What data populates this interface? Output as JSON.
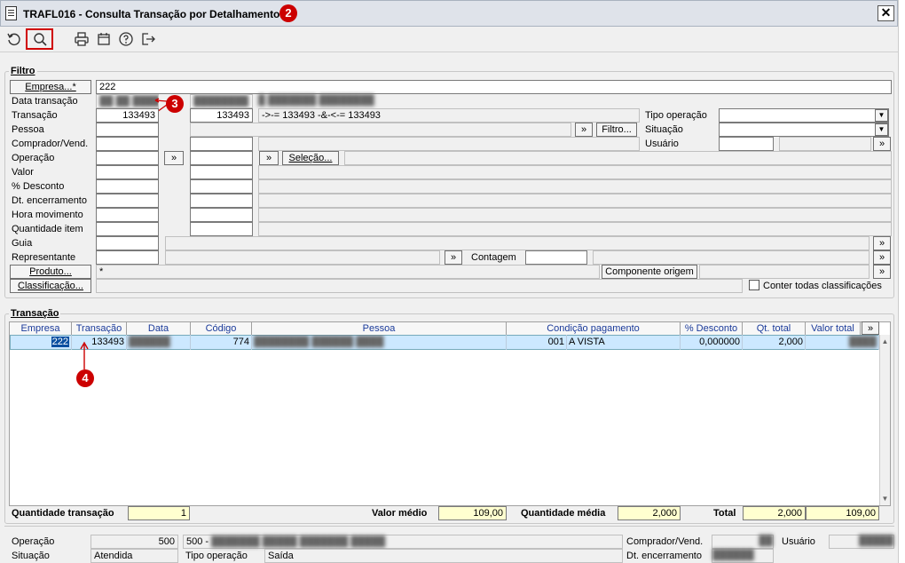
{
  "window": {
    "title": "TRAFL016 - Consulta Transação por Detalhamento",
    "close_glyph": "✕",
    "badges": {
      "b2": "2",
      "b3": "3",
      "b4": "4"
    }
  },
  "toolbar": {
    "icons": [
      "refresh-icon",
      "search-icon",
      "print-icon",
      "calendar-icon",
      "help-icon",
      "exit-icon"
    ]
  },
  "filtro": {
    "legend": "Filtro",
    "empresa_btn": "Empresa...*",
    "empresa_value": "222",
    "labels": [
      "Data transação",
      "Transação",
      "Pessoa",
      "Comprador/Vend.",
      "Operação",
      "Valor",
      "% Desconto",
      "Dt. encerramento",
      "Hora movimento",
      "Quantidade item",
      "Guia",
      "Representante"
    ],
    "transacao_from": "133493",
    "transacao_to": "133493",
    "transacao_expr": "->-= 133493 -&-<-= 133493",
    "filtro_btn": "Filtro...",
    "selecao_btn": "Seleção...",
    "tipo_operacao_label": "Tipo operação",
    "situacao_label": "Situação",
    "usuario_label": "Usuário",
    "contagem_label": "Contagem",
    "produto_btn": "Produto...",
    "produto_value": "*",
    "componente_label": "Componente origem",
    "classificacao_btn": "Classificação...",
    "conter_label": "Conter todas classificações",
    "more": "»"
  },
  "transacao": {
    "legend": "Transação",
    "columns": [
      "Empresa",
      "Transação",
      "Data",
      "Código",
      "Pessoa",
      "Condição pagamento",
      "% Desconto",
      "Qt. total",
      "Valor total"
    ],
    "row": {
      "empresa": "222",
      "transacao": "133493",
      "codigo": "774",
      "cond_code": "001",
      "cond": "A VISTA",
      "desconto": "0,000000",
      "qt_total": "2,000"
    }
  },
  "totals": {
    "qtd_transacao_label": "Quantidade transação",
    "qtd_transacao": "1",
    "valor_medio_label": "Valor médio",
    "valor_medio": "109,00",
    "qtd_media_label": "Quantidade média",
    "qtd_media": "2,000",
    "total_label": "Total",
    "total_qt": "2,000",
    "total_valor": "109,00"
  },
  "footer": {
    "operacao_label": "Operação",
    "operacao_value": "500",
    "operacao_desc": "500 -",
    "situacao_label": "Situação",
    "situacao_value": "Atendida",
    "tipo_operacao_label": "Tipo operação",
    "tipo_operacao_value": "Saída",
    "comprador_label": "Comprador/Vend.",
    "usuario_label": "Usuário",
    "dt_enc_label": "Dt. encerramento"
  },
  "colors": {
    "highlight": "#cce8ff",
    "badge": "#cc0000",
    "annotation_box": "#d00000"
  }
}
